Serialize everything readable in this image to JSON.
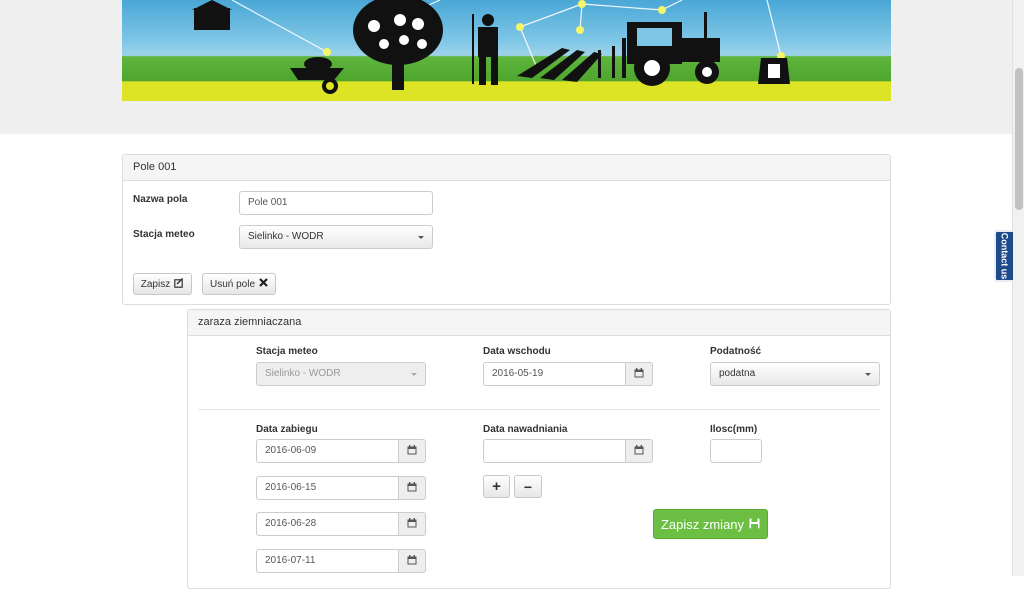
{
  "field_panel": {
    "title": "Pole 001",
    "name_label": "Nazwa pola",
    "name_value": "Pole 001",
    "station_label": "Stacja meteo",
    "station_value": "Sielinko - WODR",
    "save_label": "Zapisz",
    "delete_label": "Usuń pole"
  },
  "disease_panel": {
    "title": "zaraza ziemniaczana",
    "station_label": "Stacja meteo",
    "station_value": "Sielinko - WODR",
    "emergence_label": "Data wschodu",
    "emergence_value": "2016-05-19",
    "susceptibility_label": "Podatność",
    "susceptibility_value": "podatna",
    "treatment_label": "Data zabiegu",
    "treatment_dates": [
      "2016-06-09",
      "2016-06-15",
      "2016-06-28",
      "2016-07-11"
    ],
    "irrigation_label": "Data nawadniania",
    "irrigation_value": "",
    "amount_label": "Ilosc(mm)",
    "amount_value": "",
    "add_symbol": "+",
    "remove_symbol": "−",
    "save_changes_label": "Zapisz zmiany"
  },
  "contact_tab": "Contact us",
  "icons": {
    "calendar": "calendar-icon",
    "edit": "edit-icon",
    "delete": "times-icon",
    "floppy": "floppy-icon",
    "plus": "plus-icon",
    "minus": "minus-icon"
  },
  "colors": {
    "success": "#6cbf43",
    "contact_tab": "#1f4a8a",
    "banner_sky": "#7ec6e6",
    "banner_grass": "#4ea62e",
    "banner_ground": "#dde325"
  }
}
